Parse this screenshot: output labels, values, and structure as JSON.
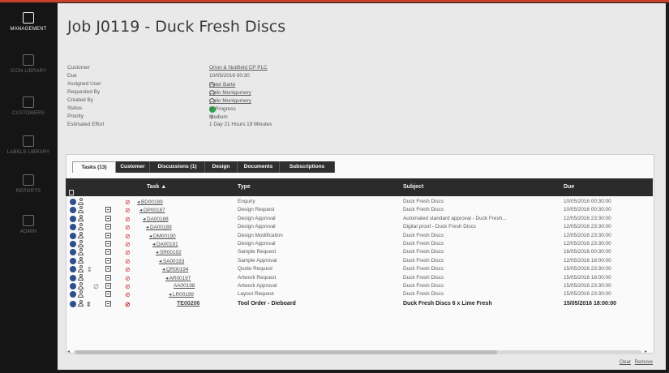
{
  "app": {
    "accent": "#c8402a"
  },
  "sidebar": {
    "items": [
      {
        "label": "Management",
        "icon": "management-icon",
        "active": true
      },
      {
        "label": "Icon Library",
        "icon": "library-icon",
        "active": false
      },
      {
        "label": "Customers",
        "icon": "customers-icon",
        "active": false
      },
      {
        "label": "Labels Library",
        "icon": "labels-icon",
        "active": false
      },
      {
        "label": "Reports",
        "icon": "reports-icon",
        "active": false
      },
      {
        "label": "Admin",
        "icon": "admin-icon",
        "active": false
      }
    ]
  },
  "page": {
    "title": "Job J0119 - Duck Fresh Discs"
  },
  "details": {
    "customer_label": "Customer",
    "customer": "Orion & Nuttfield CP PLC",
    "due_label": "Due",
    "due": "10/05/2016 00:30",
    "assigned_label": "Assigned User",
    "assigned": "Peter Barte",
    "requested_label": "Requested By",
    "requested": "Colin Montgomery",
    "created_label": "Created By",
    "created": "Colin Montgomery",
    "status_label": "Status",
    "status": "In Progress",
    "status_color": "#2ea84a",
    "priority_label": "Priority",
    "priority": "Medium",
    "effort_label": "Estimated Effort",
    "effort": "1 Day 21 Hours 19 Minutes"
  },
  "tabs": [
    {
      "label": "Tasks (13)"
    },
    {
      "label": "Customer"
    },
    {
      "label": "Discussions (1)"
    },
    {
      "label": "Design"
    },
    {
      "label": "Documents"
    },
    {
      "label": "Subscriptions"
    }
  ],
  "grid": {
    "headers": {
      "task": "Task ▲",
      "type": "Type",
      "subject": "Subject",
      "due": "Due"
    },
    "rows": [
      {
        "task": "◂ BD00189",
        "type": "Enquiry",
        "subject": "Duck Fresh Discs",
        "due": "10/05/2016 00:30:00"
      },
      {
        "task": "◂ DP00187",
        "type": "Design Request",
        "subject": "Duck Fresh Discs",
        "due": "10/05/2016 00:30:00"
      },
      {
        "task": "◂ DA00188",
        "type": "Design Approval",
        "subject": "Automated standard approval - Duck Fresh...",
        "due": "12/05/2016 23:30:00"
      },
      {
        "task": "◂ DA00189",
        "type": "Design Approval",
        "subject": "Digital proof - Duck Fresh Discs",
        "due": "12/05/2016 23:30:00"
      },
      {
        "task": "◂ DM00190",
        "type": "Design Modification",
        "subject": "Duck Fresh Discs",
        "due": "12/05/2016 23:30:00"
      },
      {
        "task": "◂ DA00191",
        "type": "Design Approval",
        "subject": "Duck Fresh Discs",
        "due": "12/05/2016 23:30:00"
      },
      {
        "task": "◂ SR00192",
        "type": "Sample Request",
        "subject": "Duck Fresh Discs",
        "due": "16/05/2016 00:30:00"
      },
      {
        "task": "◂ SA00193",
        "type": "Sample Approval",
        "subject": "Duck Fresh Discs",
        "due": "12/05/2016 18:00:00"
      },
      {
        "task": "◂ QR00194",
        "type": "Quote Request",
        "subject": "Duck Fresh Discs",
        "due": "15/05/2016 23:30:00"
      },
      {
        "task": "◂ AR00197",
        "type": "Artwork Request",
        "subject": "Duck Fresh Discs",
        "due": "15/05/2016 18:00:00"
      },
      {
        "task": "AA00198",
        "type": "Artwork Approval",
        "subject": "Duck Fresh Discs",
        "due": "15/05/2016 23:30:00"
      },
      {
        "task": "◂ LR00199",
        "type": "Layout Request",
        "subject": "Duck Fresh Discs",
        "due": "15/05/2016 23:30:00"
      },
      {
        "task": "TE00206",
        "type": "Tool Order - Dieboard",
        "subject": "Duck Fresh Discs 6 x Lime Fresh",
        "due": "15/05/2016 18:00:00",
        "bold": true
      }
    ]
  },
  "footer": {
    "clear": "Clear",
    "remove": "Remove"
  }
}
